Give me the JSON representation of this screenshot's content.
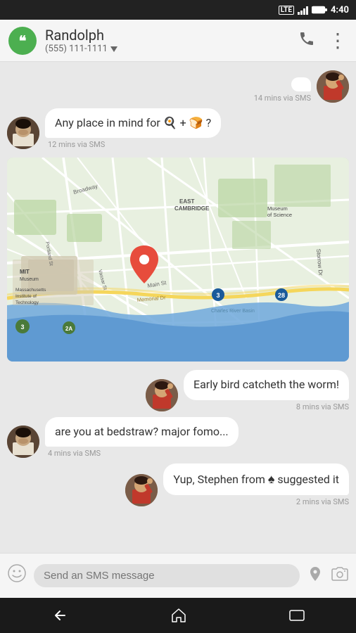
{
  "statusBar": {
    "time": "4:40",
    "lte": "LTE",
    "battery": "🔋"
  },
  "appBar": {
    "contactName": "Randolph",
    "contactNumber": "(555) 111-1111",
    "callIcon": "📞",
    "moreIcon": "⋮"
  },
  "messages": [
    {
      "id": "msg1",
      "type": "incoming_partial",
      "time": "14 mins via SMS",
      "avatar": "person1"
    },
    {
      "id": "msg2",
      "type": "incoming",
      "text": "Any place in mind for 🍳 + 🍞 ?",
      "time": "12 mins via SMS",
      "avatar": "person1"
    },
    {
      "id": "msg3",
      "type": "map",
      "time": ""
    },
    {
      "id": "msg4",
      "type": "outgoing",
      "text": "Early bird catcheth the worm!",
      "time": "8 mins via SMS",
      "avatar": "person2"
    },
    {
      "id": "msg5",
      "type": "incoming",
      "text": "are you at bedstraw? major fomo...",
      "time": "4 mins via SMS",
      "avatar": "person1"
    },
    {
      "id": "msg6",
      "type": "outgoing",
      "text": "Yup, Stephen from ♠ suggested it",
      "time": "2 mins via SMS",
      "avatar": "person2"
    }
  ],
  "bottomBar": {
    "placeholder": "Send an SMS message",
    "emojiIcon": "😊",
    "locationIcon": "📍",
    "cameraIcon": "📷"
  },
  "navBar": {
    "backIcon": "←",
    "homeIcon": "⌂",
    "recentIcon": "▭"
  }
}
